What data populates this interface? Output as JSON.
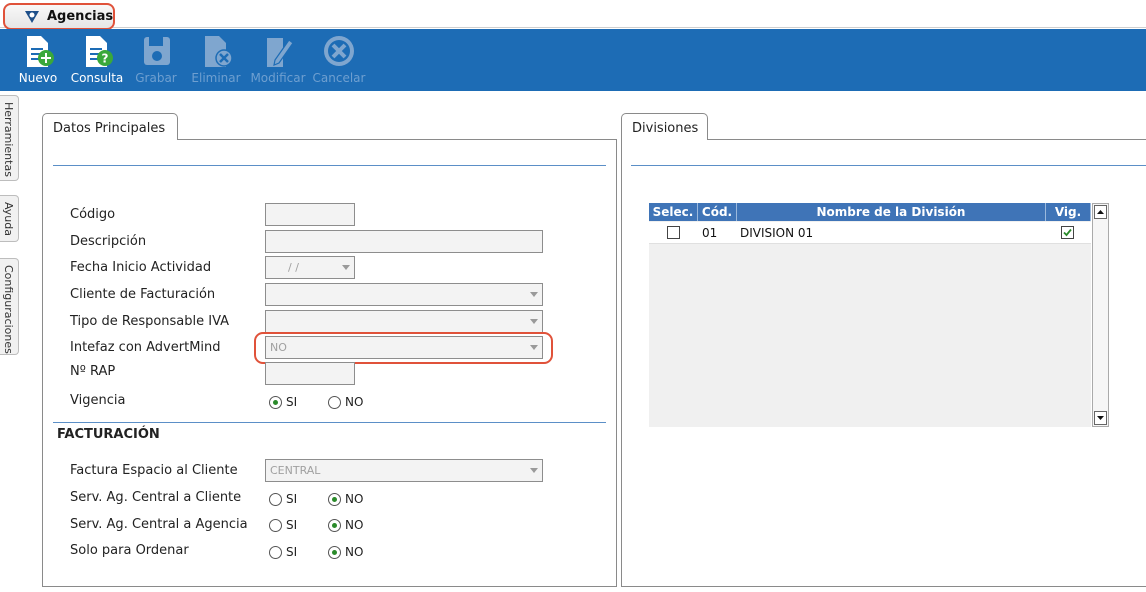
{
  "window": {
    "title": "Agencias"
  },
  "toolbar": {
    "nuevo": "Nuevo",
    "consulta": "Consulta",
    "grabar": "Grabar",
    "eliminar": "Eliminar",
    "modificar": "Modificar",
    "cancelar": "Cancelar"
  },
  "side_tabs": [
    "Herramientas",
    "Ayuda",
    "Configuraciones"
  ],
  "main": {
    "tab_label": "Datos Principales",
    "fields": {
      "codigo": "Código",
      "descripcion": "Descripción",
      "fecha": "Fecha Inicio Actividad",
      "fecha_value": "/ /",
      "cliente": "Cliente de Facturación",
      "tipo_iva": "Tipo de Responsable IVA",
      "advertmind": "Intefaz con AdvertMind",
      "advertmind_value": "NO",
      "rap": "Nº RAP",
      "vigencia": "Vigencia"
    },
    "radio_si": "SI",
    "radio_no": "NO",
    "facturacion": {
      "title": "FACTURACIÓN",
      "factura_espacio": "Factura Espacio al Cliente",
      "factura_espacio_value": "CENTRAL",
      "serv_cliente": "Serv. Ag. Central a Cliente",
      "serv_agencia": "Serv. Ag. Central a Agencia",
      "solo_ordenar": "Solo para Ordenar"
    }
  },
  "divisiones": {
    "tab_label": "Divisiones",
    "columns": [
      "Selec.",
      "Cód.",
      "Nombre de la División",
      "Vig."
    ],
    "rows": [
      {
        "selected": false,
        "code": "01",
        "name": "DIVISION 01",
        "vigente": true
      }
    ]
  },
  "colors": {
    "toolbar": "#1d6cb5",
    "highlight": "#e0523a",
    "grid_header": "#3f74b7"
  }
}
